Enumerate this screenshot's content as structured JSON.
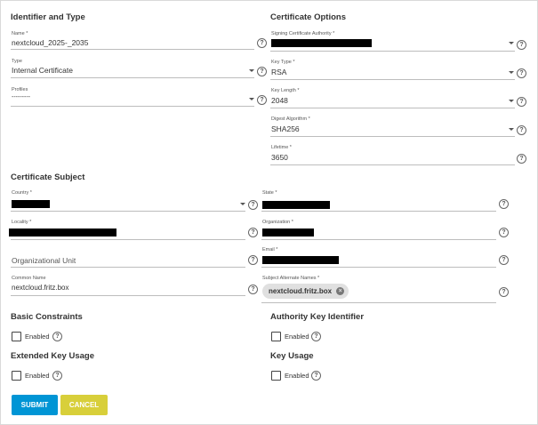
{
  "identifier": {
    "title": "Identifier and Type",
    "name_label": "Name *",
    "name_value": "nextcloud_2025-_2035",
    "type_label": "Type",
    "type_value": "Internal Certificate",
    "profiles_label": "Profiles",
    "profiles_value": "---------"
  },
  "options": {
    "title": "Certificate Options",
    "ca_label": "Signing Certificate Authority *",
    "keytype_label": "Key Type *",
    "keytype_value": "RSA",
    "keylength_label": "Key Length *",
    "keylength_value": "2048",
    "digest_label": "Digest Algorithm *",
    "digest_value": "SHA256",
    "lifetime_label": "Lifetime *",
    "lifetime_value": "3650"
  },
  "subject": {
    "title": "Certificate Subject",
    "country_label": "Country *",
    "state_label": "State *",
    "locality_label": "Locality *",
    "organization_label": "Organization *",
    "ou_placeholder": "Organizational Unit",
    "email_label": "Email *",
    "cn_label": "Common Name",
    "cn_value": "nextcloud.fritz.box",
    "san_label": "Subject Alternate Names *",
    "san_chip": "nextcloud.fritz.box"
  },
  "extensions": {
    "basic_title": "Basic Constraints",
    "aki_title": "Authority Key Identifier",
    "eku_title": "Extended Key Usage",
    "ku_title": "Key Usage",
    "enabled_label": "Enabled"
  },
  "icons": {
    "help": "?",
    "chip_remove": "×"
  },
  "buttons": {
    "submit": "SUBMIT",
    "cancel": "CANCEL"
  },
  "colors": {
    "submit": "#0095d5",
    "cancel": "#d8cf3a",
    "redaction": "#000000"
  }
}
